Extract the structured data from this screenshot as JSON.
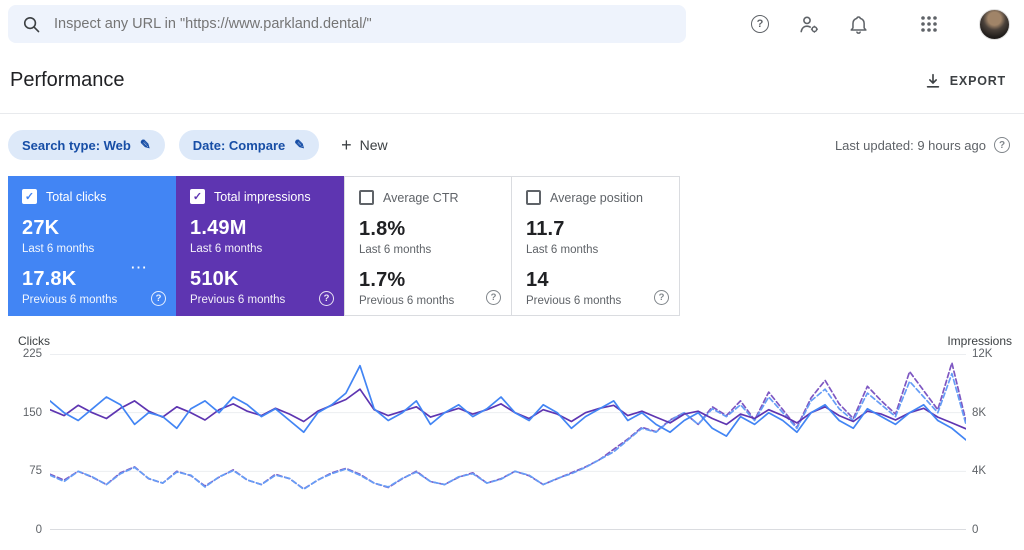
{
  "topbar": {
    "search_placeholder": "Inspect any URL in \"https://www.parkland.dental/\""
  },
  "header": {
    "title": "Performance",
    "export_label": "EXPORT"
  },
  "filters": {
    "search_type_chip": "Search type: Web",
    "date_chip": "Date: Compare",
    "new_label": "New",
    "last_updated": "Last updated: 9 hours ago"
  },
  "icons": {
    "help": "?",
    "check": "✓",
    "pencil": "✎",
    "plus": "+",
    "more": "⋯"
  },
  "cards": [
    {
      "label": "Total clicks",
      "checked": true,
      "value1": "27K",
      "period1": "Last 6 months",
      "value2": "17.8K",
      "period2": "Previous 6 months",
      "color": "#4285f4"
    },
    {
      "label": "Total impressions",
      "checked": true,
      "value1": "1.49M",
      "period1": "Last 6 months",
      "value2": "510K",
      "period2": "Previous 6 months",
      "color": "#5e35b1"
    },
    {
      "label": "Average CTR",
      "checked": false,
      "value1": "1.8%",
      "period1": "Last 6 months",
      "value2": "1.7%",
      "period2": "Previous 6 months",
      "color": "#ffffff"
    },
    {
      "label": "Average position",
      "checked": false,
      "value1": "11.7",
      "period1": "Last 6 months",
      "value2": "14",
      "period2": "Previous 6 months",
      "color": "#ffffff"
    }
  ],
  "chart_data": {
    "type": "line",
    "grid": "horizontal",
    "left_axis": {
      "label": "Clicks",
      "max": 225,
      "ticks": [
        "225",
        "150",
        "75",
        "0"
      ]
    },
    "right_axis": {
      "label": "Impressions",
      "max": 12000,
      "ticks": [
        "12K",
        "8K",
        "4K",
        "0"
      ]
    },
    "series": [
      {
        "name": "Impressions - Previous 6 months",
        "axis": "right",
        "style": "dashed",
        "color": "#7e57c2",
        "values": [
          3800,
          3400,
          4000,
          3600,
          3100,
          3900,
          4300,
          3500,
          3200,
          4000,
          3700,
          3000,
          3600,
          4100,
          3400,
          3100,
          3800,
          3500,
          2800,
          3400,
          3900,
          4200,
          3800,
          3200,
          2900,
          3500,
          4000,
          3300,
          3100,
          3600,
          3900,
          3200,
          3500,
          4000,
          3700,
          3100,
          3500,
          3900,
          4300,
          4800,
          5500,
          6200,
          7000,
          6700,
          7500,
          8000,
          7200,
          8400,
          7800,
          8800,
          7500,
          9400,
          8200,
          7000,
          9000,
          10200,
          8600,
          7600,
          9800,
          8800,
          7900,
          10800,
          9500,
          8200,
          11400,
          7400
        ]
      },
      {
        "name": "Clicks - Previous 6 months",
        "axis": "left",
        "style": "dashed",
        "color": "#669df6",
        "values": [
          70,
          62,
          75,
          68,
          58,
          72,
          80,
          66,
          60,
          74,
          70,
          55,
          68,
          76,
          64,
          58,
          70,
          66,
          52,
          64,
          72,
          78,
          70,
          60,
          55,
          66,
          74,
          62,
          58,
          68,
          72,
          60,
          65,
          75,
          70,
          58,
          66,
          72,
          80,
          90,
          100,
          115,
          130,
          125,
          140,
          150,
          135,
          155,
          145,
          160,
          140,
          170,
          150,
          130,
          165,
          180,
          155,
          140,
          175,
          160,
          145,
          190,
          170,
          150,
          200,
          135
        ]
      },
      {
        "name": "Impressions - Last 6 months",
        "axis": "right",
        "style": "solid",
        "color": "#5e35b1",
        "values": [
          8200,
          7800,
          8500,
          8000,
          7600,
          8300,
          8800,
          8100,
          7700,
          8400,
          8000,
          7500,
          8200,
          8600,
          8100,
          7800,
          8300,
          7900,
          7400,
          8100,
          8500,
          8900,
          9600,
          8200,
          7800,
          8100,
          8400,
          7700,
          8000,
          8300,
          7900,
          8200,
          8600,
          8000,
          7600,
          8200,
          7900,
          7400,
          8000,
          8300,
          8500,
          7800,
          8100,
          7700,
          7300,
          7900,
          8100,
          7600,
          7200,
          7900,
          7600,
          8200,
          7800,
          7300,
          8000,
          8400,
          7800,
          7400,
          8100,
          7900,
          7500,
          8000,
          8300,
          7700,
          7300,
          6900
        ]
      },
      {
        "name": "Clicks - Last 6 months",
        "axis": "left",
        "style": "solid",
        "color": "#4285f4",
        "values": [
          165,
          150,
          140,
          155,
          170,
          160,
          135,
          150,
          145,
          130,
          155,
          165,
          150,
          170,
          160,
          145,
          155,
          140,
          125,
          150,
          160,
          175,
          210,
          155,
          140,
          150,
          165,
          135,
          150,
          160,
          145,
          155,
          170,
          150,
          140,
          160,
          150,
          130,
          145,
          155,
          165,
          140,
          150,
          135,
          125,
          140,
          150,
          130,
          120,
          145,
          135,
          150,
          140,
          125,
          150,
          160,
          140,
          130,
          155,
          145,
          135,
          150,
          160,
          140,
          130,
          115
        ]
      }
    ]
  }
}
